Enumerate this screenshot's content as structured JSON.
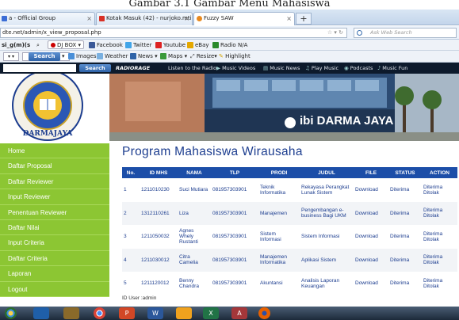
{
  "caption": "Gambar 3.1 Gambar Menu Mahasiswa",
  "browser": {
    "tabs": [
      {
        "label": "a - Official Group",
        "color": "#3b6dd6",
        "active": false
      },
      {
        "label": "Kotak Masuk (42) - nurjoko.mti@gm...",
        "color": "#d93025",
        "active": false
      },
      {
        "label": "Fuzzy SAW",
        "color": "#e8891f",
        "active": true
      }
    ],
    "new_tab": "+",
    "url": "dte.net/admin/x_view_proposal.php",
    "search_placeholder": "Ask Web Search",
    "toolbar1": {
      "prefix": "si_g(m)(s",
      "djbox": "DJ BOX",
      "items": [
        "Facebook",
        "Twitter",
        "Youtube",
        "eBay",
        "Radio",
        "N/A"
      ]
    },
    "toolbar2": {
      "search_btn": "Search",
      "items": [
        "Images",
        "Weather",
        "News",
        "Maps",
        "Resize",
        "Highlight"
      ]
    },
    "toolbar3": {
      "search_btn": "Search",
      "radio": "RADIORAGE",
      "items": [
        "Listen to the Radio",
        "Music Videos",
        "Music News",
        "Play Music",
        "Podcasts",
        "Music Fun"
      ]
    }
  },
  "site": {
    "logo_text": "INFORMATICS & BUSINESS INSTITUTE DARMAJAYA",
    "banner_text": "ibi DARMA JAYA",
    "menu": [
      "Home",
      "Daftar Proposal",
      "Daftar Reviewer",
      "Input Reviewer",
      "Penentuan Reviewer",
      "Daftar Nilai",
      "Input Criteria",
      "Daftar Criteria",
      "Laporan",
      "Logout"
    ],
    "page_title": "Program Mahasiswa Wirausaha",
    "columns": [
      "No.",
      "ID MHS",
      "NAMA",
      "TLP",
      "PRODI",
      "JUDUL",
      "FILE",
      "STATUS",
      "ACTION"
    ],
    "rows": [
      {
        "no": "1",
        "id": "1211010230",
        "nama": "Suci Mutiara",
        "tlp": "081957303901",
        "prodi": "Teknik Informatika",
        "judul": "Rekayasa Perangkat Lunak Sistem",
        "file": "Download",
        "status": "Diterima",
        "a1": "Diterima",
        "a2": "Ditolak"
      },
      {
        "no": "2",
        "id": "1312110261",
        "nama": "Liza",
        "tlp": "081957303901",
        "prodi": "Manajemen",
        "judul": "Pengembangan e-business Bagi UKM",
        "file": "Download",
        "status": "Diterima",
        "a1": "Diterima",
        "a2": "Ditolak"
      },
      {
        "no": "3",
        "id": "1211050032",
        "nama": "Agnes Whely Rustanti",
        "tlp": "081957303901",
        "prodi": "Sistem Informasi",
        "judul": "Sistem Informasi",
        "file": "Download",
        "status": "Diterima",
        "a1": "Diterima",
        "a2": "Ditolak"
      },
      {
        "no": "4",
        "id": "1211030012",
        "nama": "Citra Camelia",
        "tlp": "081957303901",
        "prodi": "Manajemen Informatika",
        "judul": "Aplikasi Sistem",
        "file": "Download",
        "status": "Diterima",
        "a1": "Diterima",
        "a2": "Ditolak"
      },
      {
        "no": "5",
        "id": "1211120012",
        "nama": "Benny Chandra",
        "tlp": "081957303901",
        "prodi": "Akuntansi",
        "judul": "Analisis Laporan Keuangan",
        "file": "Download",
        "status": "Diterima",
        "a1": "Diterima",
        "a2": "Ditolak"
      }
    ],
    "id_user": "ID User :admin"
  },
  "taskbar": {
    "icons": [
      "windows-start-icon",
      "media-player-icon",
      "explorer-icon",
      "chrome-icon",
      "powerpoint-icon",
      "word-icon",
      "visio-icon",
      "excel-icon",
      "access-icon",
      "firefox-icon"
    ]
  }
}
